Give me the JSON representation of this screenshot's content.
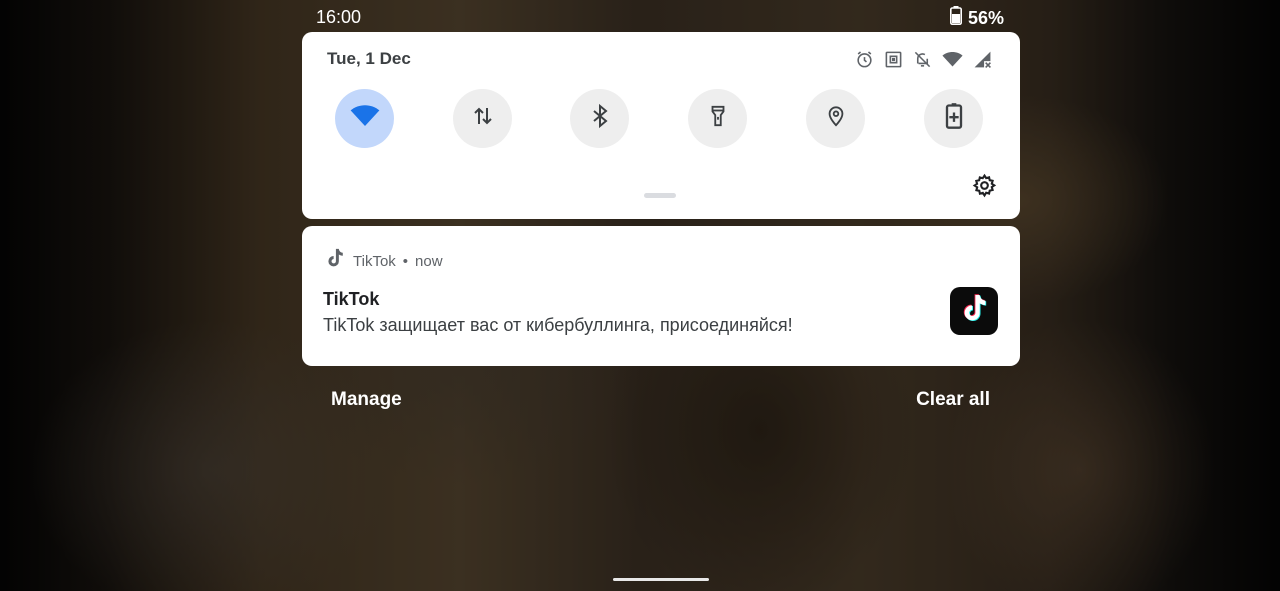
{
  "status_bar": {
    "time": "16:00",
    "battery_percent": "56%",
    "battery_icon": "battery-icon"
  },
  "quick_settings": {
    "date": "Tue, 1 Dec",
    "status_icons": [
      "alarm-icon",
      "nfc-icon",
      "notifications-off-icon",
      "wifi-icon",
      "cellular-no-data-icon"
    ],
    "tiles": [
      {
        "icon": "wifi-icon",
        "active": true
      },
      {
        "icon": "mobile-data-icon",
        "active": false
      },
      {
        "icon": "bluetooth-icon",
        "active": false
      },
      {
        "icon": "flashlight-icon",
        "active": false
      },
      {
        "icon": "location-icon",
        "active": false
      },
      {
        "icon": "battery-saver-icon",
        "active": false
      }
    ],
    "active_color": "#c2d7fb",
    "accent_color": "#1a73e8",
    "settings_icon": "gear-icon"
  },
  "notification": {
    "app_name": "TikTok",
    "separator": "•",
    "time": "now",
    "title": "TikTok",
    "text": "TikTok защищает вас от кибербуллинга, присоединяйся!",
    "app_icon": "tiktok-icon"
  },
  "footer": {
    "manage_label": "Manage",
    "clear_all_label": "Clear all"
  }
}
